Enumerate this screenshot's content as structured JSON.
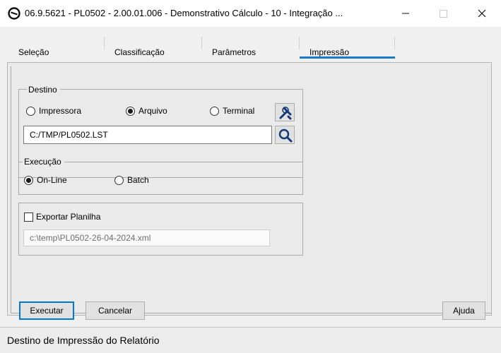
{
  "window": {
    "title": "06.9.5621 - PL0502 - 2.00.01.006 - Demonstrativo Cálculo - 10 - Integração ...",
    "icon": "app-logo-icon",
    "controls": [
      "minimize-icon",
      "maximize-icon",
      "close-icon"
    ]
  },
  "tabs": [
    {
      "label": "Seleção",
      "active": false
    },
    {
      "label": "Classificação",
      "active": false
    },
    {
      "label": "Parâmetros",
      "active": false
    },
    {
      "label": "Impressão",
      "active": true
    }
  ],
  "accent_color": "#1979ca",
  "destino": {
    "title": "Destino",
    "options": [
      {
        "label": "Impressora",
        "selected": false
      },
      {
        "label": "Arquivo",
        "selected": true
      },
      {
        "label": "Terminal",
        "selected": false
      }
    ],
    "path_value": "C:/TMP/PL0502.LST",
    "config_icon": "tools-icon",
    "search_icon": "search-icon"
  },
  "execucao": {
    "title": "Execução",
    "options": [
      {
        "label": "On-Line",
        "selected": true
      },
      {
        "label": "Batch",
        "selected": false
      }
    ]
  },
  "exportar": {
    "checkbox_label": "Exportar Planilha",
    "checked": false,
    "file_value": "c:\\temp\\PL0502-26-04-2024.xml"
  },
  "buttons": {
    "executar": "Executar",
    "cancelar": "Cancelar",
    "ajuda": "Ajuda"
  },
  "status": {
    "text": "Destino de Impressão do Relatório"
  }
}
